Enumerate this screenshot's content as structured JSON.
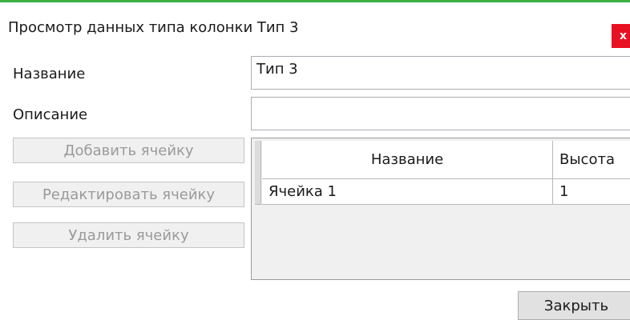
{
  "window": {
    "title": "Просмотр данных типа колонки Тип 3",
    "close_glyph": "x",
    "accent": "#3cb043",
    "close_color": "#e81123"
  },
  "form": {
    "name_label": "Название",
    "name_value": "Тип 3",
    "description_label": "Описание",
    "description_value": ""
  },
  "buttons": {
    "add_cell": "Добавить ячейку",
    "edit_cell": "Редактировать ячейку",
    "delete_cell": "Удалить ячейку",
    "close": "Закрыть"
  },
  "grid": {
    "columns": [
      "Название",
      "Высота"
    ],
    "rows": [
      [
        "Ячейка 1",
        "1"
      ]
    ]
  }
}
